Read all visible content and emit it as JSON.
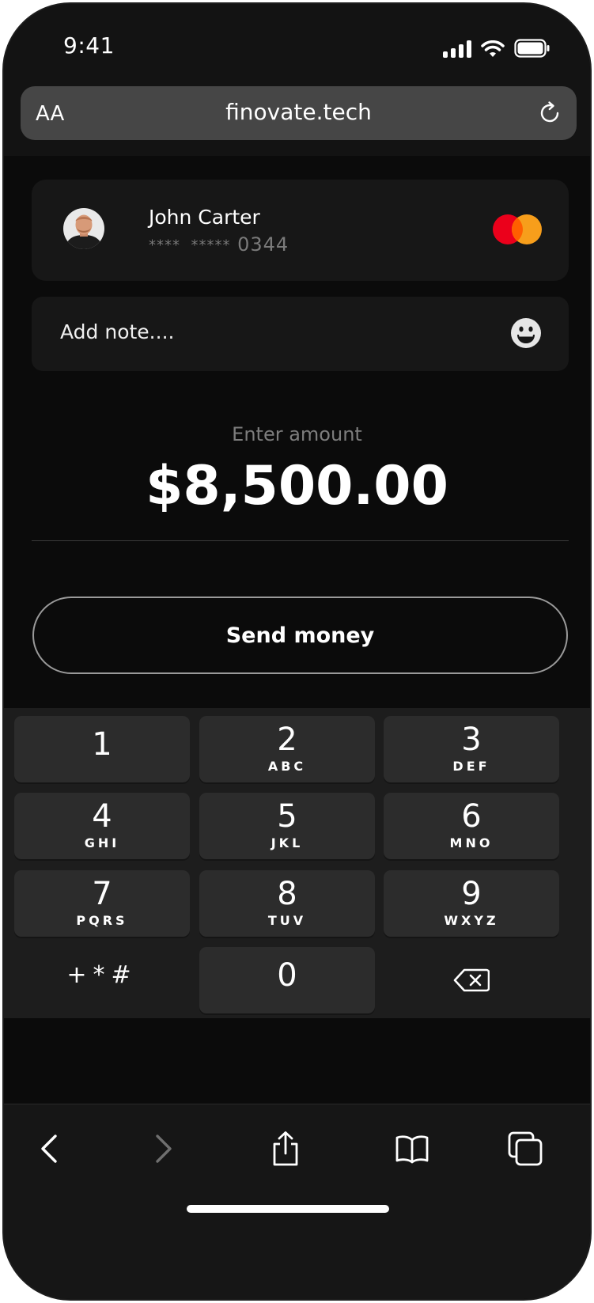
{
  "status_bar": {
    "time": "9:41"
  },
  "browser": {
    "text_size_label": "AA",
    "url": "finovate.tech"
  },
  "recipient": {
    "name": "John Carter",
    "card_mask": "****  *****",
    "card_last4": "0344"
  },
  "note": {
    "placeholder": "Add note...."
  },
  "amount": {
    "label": "Enter amount",
    "value": "$8,500.00"
  },
  "send_button": {
    "label": "Send money"
  },
  "keypad": {
    "keys": [
      {
        "digit": "1",
        "letters": ""
      },
      {
        "digit": "2",
        "letters": "ABC"
      },
      {
        "digit": "3",
        "letters": "DEF"
      },
      {
        "digit": "4",
        "letters": "GHI"
      },
      {
        "digit": "5",
        "letters": "JKL"
      },
      {
        "digit": "6",
        "letters": "MNO"
      },
      {
        "digit": "7",
        "letters": "PQRS"
      },
      {
        "digit": "8",
        "letters": "TUV"
      },
      {
        "digit": "9",
        "letters": "WXYZ"
      },
      {
        "digit": "0",
        "letters": ""
      }
    ],
    "symbols": "+*#"
  },
  "icons": {
    "signal": "cellular-signal-icon",
    "wifi": "wifi-icon",
    "battery": "battery-icon",
    "reload": "reload-icon",
    "card_brand": "mastercard-icon",
    "emoji": "smiley-icon",
    "backspace": "backspace-icon",
    "back": "chevron-left-icon",
    "forward": "chevron-right-icon",
    "share": "share-icon",
    "bookmarks": "book-icon",
    "tabs": "tabs-icon"
  },
  "colors": {
    "mastercard_red": "#eb001b",
    "mastercard_orange": "#f79e1b"
  }
}
